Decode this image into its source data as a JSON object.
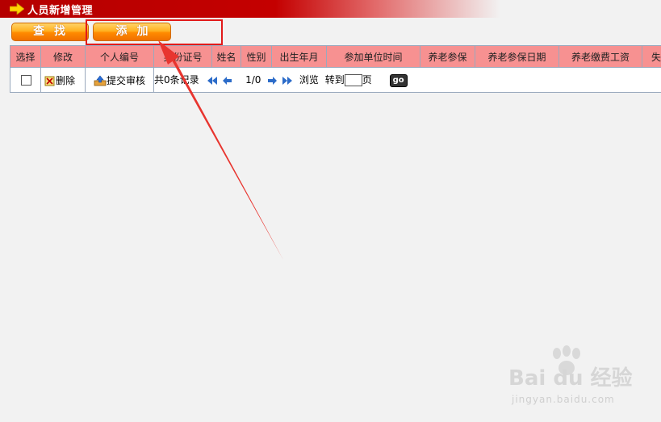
{
  "window": {
    "title": "人员新增管理"
  },
  "toolbar": {
    "find_label": "查找",
    "add_label": "添加"
  },
  "table": {
    "columns": [
      "选择",
      "修改",
      "个人编号",
      "身份证号",
      "姓名",
      "性别",
      "出生年月",
      "参加单位时间",
      "养老参保",
      "养老参保日期",
      "养老缴费工资",
      "失业"
    ],
    "row": {
      "delete_label": "删除",
      "submit_label": "提交审核",
      "pager": {
        "total_text": "共0条记录",
        "page_text": "1/0",
        "browse_label": "浏览",
        "goto_label": "转到",
        "page_unit": "页",
        "go_label": "go"
      }
    }
  },
  "watermark": {
    "main": "Bai du 经验",
    "sub": "jingyan.baidu.com"
  },
  "colors": {
    "title_bar": "#c40000",
    "header_bg": "#f79191",
    "button": "#ff8a00",
    "highlight": "#e21a1a"
  }
}
